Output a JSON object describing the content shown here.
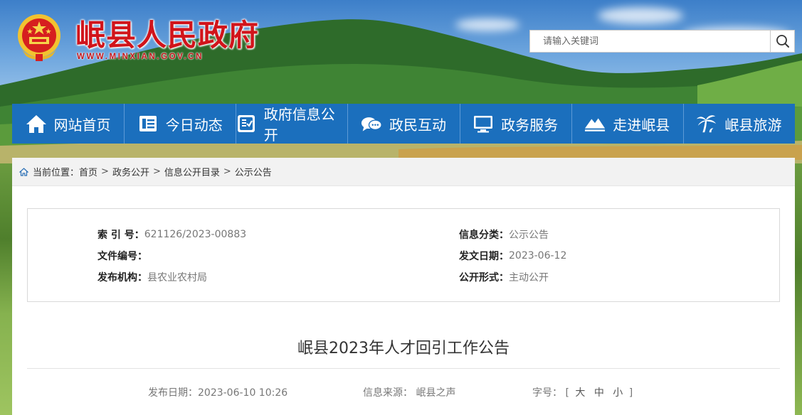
{
  "header": {
    "site_title": "岷县人民政府",
    "site_url": "WWW.MINXIAN.GOV.CN",
    "search_placeholder": "请输入关键词"
  },
  "nav": [
    {
      "label": "网站首页",
      "icon": "home-icon"
    },
    {
      "label": "今日动态",
      "icon": "news-icon"
    },
    {
      "label": "政府信息公开",
      "icon": "document-check-icon"
    },
    {
      "label": "政民互动",
      "icon": "chat-icon"
    },
    {
      "label": "政务服务",
      "icon": "monitor-icon"
    },
    {
      "label": "走进岷县",
      "icon": "mountain-icon"
    },
    {
      "label": "岷县旅游",
      "icon": "palm-tree-icon"
    }
  ],
  "breadcrumb": {
    "prefix": "当前位置：",
    "items": [
      "首页",
      "政务公开",
      "信息公开目录",
      "公示公告"
    ]
  },
  "meta": {
    "index_label": "索 引 号：",
    "index_value": "621126/2023-00883",
    "category_label": "信息分类：",
    "category_value": "公示公告",
    "doc_no_label": "文件编号：",
    "doc_no_value": "",
    "issue_date_label": "发文日期：",
    "issue_date_value": "2023-06-12",
    "org_label": "发布机构：",
    "org_value": "县农业农村局",
    "form_label": "公开形式：",
    "form_value": "主动公开"
  },
  "article": {
    "title": "岷县2023年人才回引工作公告",
    "publish_label": "发布日期：",
    "publish_value": "2023-06-10 10:26",
    "source_label": "信息来源：",
    "source_value": "岷县之声",
    "font_size_label": "字号：",
    "bracket_open": "[",
    "size_large": "大",
    "size_medium": "中",
    "size_small": "小",
    "bracket_close": "]"
  },
  "colors": {
    "brand_red": "#d1141b",
    "nav_blue": "#1b6fbd"
  }
}
